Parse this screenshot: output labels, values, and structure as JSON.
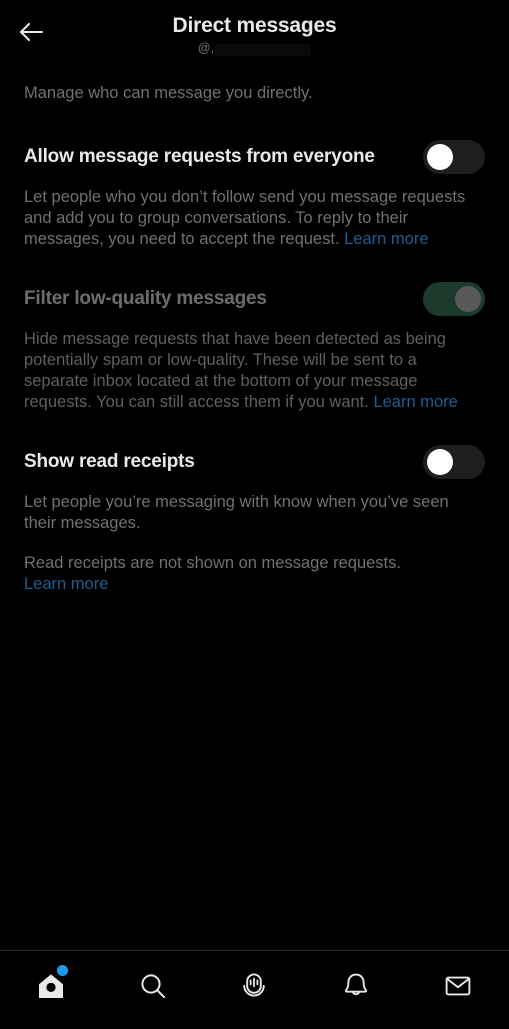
{
  "header": {
    "back_icon": "back-arrow-icon",
    "title": "Direct messages",
    "handle_prefix": "@,",
    "handle_redacted": true
  },
  "main": {
    "intro": "Manage who can message you directly.",
    "settings": [
      {
        "title": "Allow message requests from everyone",
        "description": "Let people who you don’t follow send you message requests and add you to group conversations. To reply to their messages, you need to accept the request. ",
        "link_label": "Learn more",
        "toggle_state": "off",
        "disabled": false
      },
      {
        "title": "Filter low-quality messages",
        "description": "Hide message requests that have been detected as being potentially spam or low-quality. These will be sent to a separate inbox located at the bottom of your message requests. You can still access them if you want. ",
        "link_label": "Learn more",
        "toggle_state": "on",
        "disabled": true
      },
      {
        "title": "Show read receipts",
        "description": "Let people you’re messaging with know when you’ve seen their messages.",
        "note": "Read receipts are not shown on message requests.",
        "link_label": "Learn more",
        "toggle_state": "off",
        "disabled": false
      }
    ]
  },
  "navbar": {
    "items": [
      {
        "name": "home",
        "icon": "home-icon",
        "active": true,
        "badge": true
      },
      {
        "name": "search",
        "icon": "search-icon",
        "active": false,
        "badge": false
      },
      {
        "name": "spaces",
        "icon": "microphone-icon",
        "active": false,
        "badge": false
      },
      {
        "name": "notifications",
        "icon": "bell-icon",
        "active": false,
        "badge": false
      },
      {
        "name": "messages",
        "icon": "envelope-icon",
        "active": false,
        "badge": false
      }
    ]
  },
  "colors": {
    "background": "#000000",
    "primary_text": "#e7e9ea",
    "secondary_text": "#6e7175",
    "disabled_text": "#6b6e70",
    "link": "#1d5d91",
    "accent": "#1d9bf0",
    "toggle_off_track": "#1e1e1e",
    "toggle_on_disabled_track": "#1c3b2c",
    "toggle_knob_disabled": "#595959"
  }
}
